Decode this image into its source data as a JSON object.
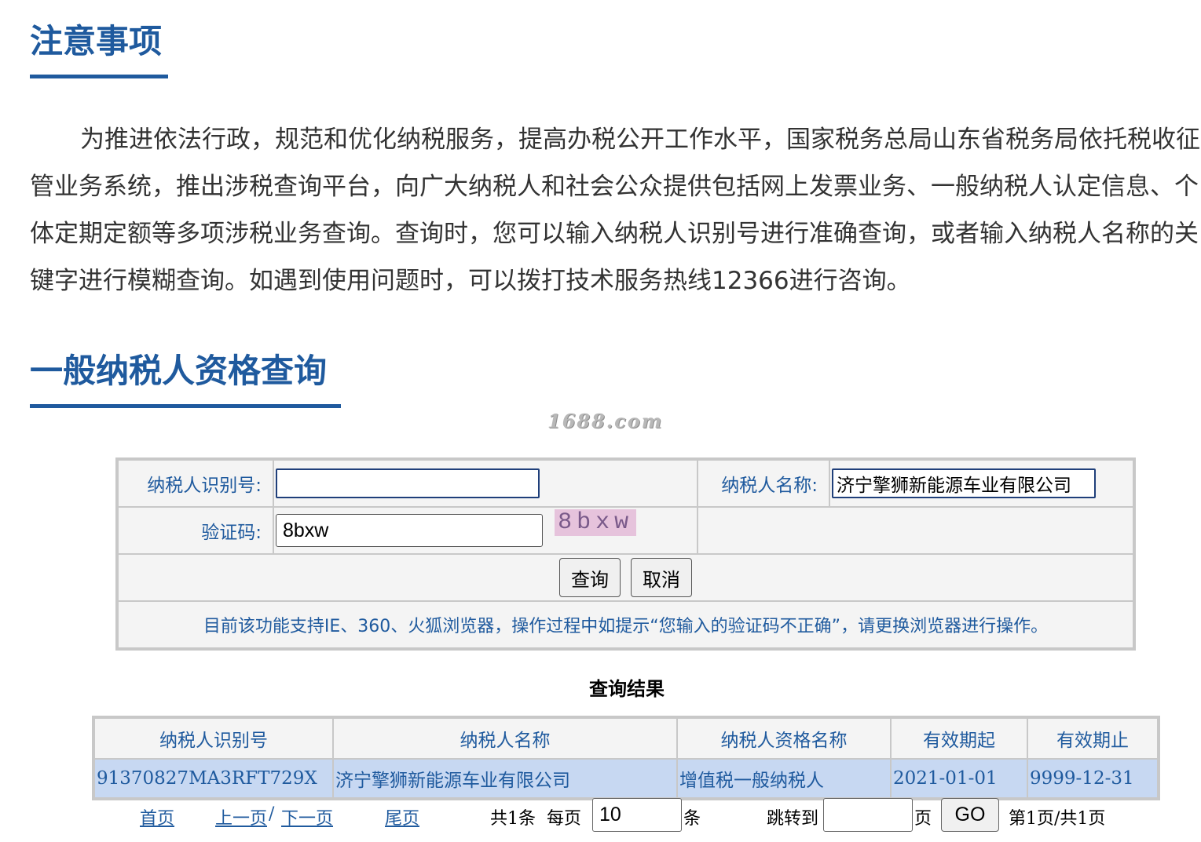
{
  "notice": {
    "title": "注意事项",
    "body": "为推进依法行政，规范和优化纳税服务，提高办税公开工作水平，国家税务总局山东省税务局依托税收征管业务系统，推出涉税查询平台，向广大纳税人和社会公众提供包括网上发票业务、一般纳税人认定信息、个体定期定额等多项涉税业务查询。查询时，您可以输入纳税人识别号进行准确查询，或者输入纳税人名称的关键字进行模糊查询。如遇到使用问题时，可以拨打技术服务热线12366进行咨询。"
  },
  "query": {
    "title": "一般纳税人资格查询",
    "watermark": "1688.com",
    "taxpayer_id_label": "纳税人识别号:",
    "taxpayer_id_value": "",
    "taxpayer_name_label": "纳税人名称:",
    "taxpayer_name_value": "济宁擎狮新能源车业有限公司",
    "captcha_label": "验证码:",
    "captcha_value": "8bxw",
    "captcha_image_text": "8bxw",
    "query_button": "查询",
    "cancel_button": "取消",
    "tip": "目前该功能支持IE、360、火狐浏览器，操作过程中如提示“您输入的验证码不正确”，请更换浏览器进行操作。"
  },
  "results": {
    "title": "查询结果",
    "headers": [
      "纳税人识别号",
      "纳税人名称",
      "纳税人资格名称",
      "有效期起",
      "有效期止"
    ],
    "rows": [
      [
        "91370827MA3RFT729X",
        "济宁擎狮新能源车业有限公司",
        "增值税一般纳税人",
        "2021-01-01",
        "9999-12-31"
      ]
    ]
  },
  "pager": {
    "first": "首页",
    "prev": "上一页",
    "sep": "/",
    "next": "下一页",
    "last": "尾页",
    "total": "共1条",
    "per_page_label": "每页",
    "per_page_value": "10",
    "per_page_unit": "条",
    "jump_label": "跳转到",
    "jump_value": "",
    "page_unit": "页",
    "go_button": "GO",
    "page_info": "第1页/共1页"
  }
}
